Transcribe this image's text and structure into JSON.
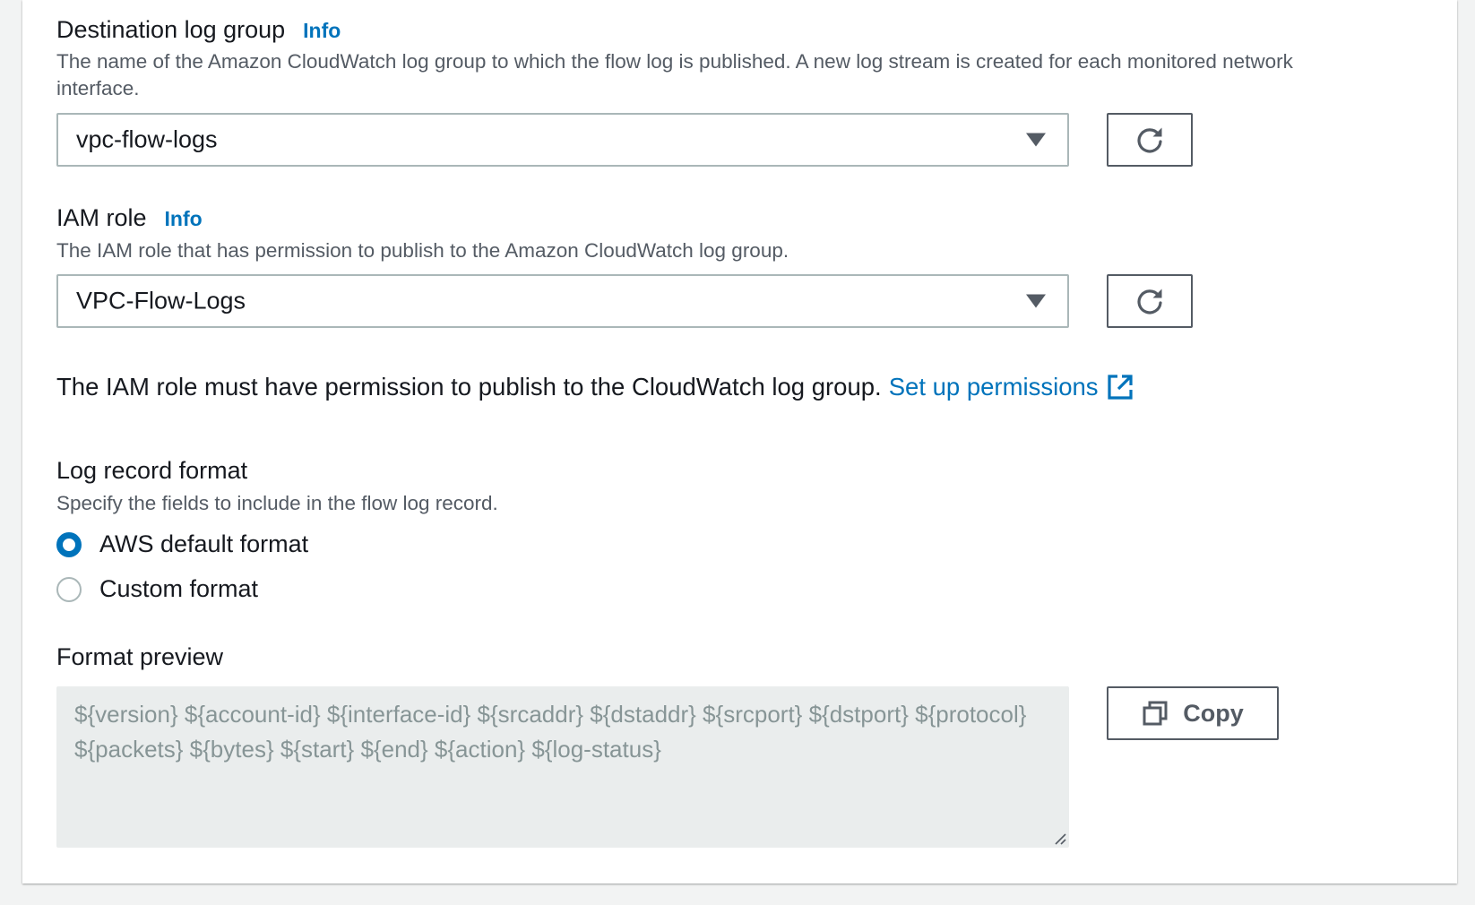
{
  "destination_log_group": {
    "label": "Destination log group",
    "info": "Info",
    "description": "The name of the Amazon CloudWatch log group to which the flow log is published. A new log stream is created for each monitored network interface.",
    "selected_value": "vpc-flow-logs"
  },
  "iam_role": {
    "label": "IAM role",
    "info": "Info",
    "description": "The IAM role that has permission to publish to the Amazon CloudWatch log group.",
    "selected_value": "VPC-Flow-Logs"
  },
  "permission_notice": {
    "text": "The IAM role must have permission to publish to the CloudWatch log group.",
    "link": "Set up permissions"
  },
  "log_record_format": {
    "label": "Log record format",
    "description": "Specify the fields to include in the flow log record.",
    "options": [
      {
        "label": "AWS default format",
        "checked": true
      },
      {
        "label": "Custom format",
        "checked": false
      }
    ]
  },
  "format_preview": {
    "label": "Format preview",
    "text": "${version} ${account-id} ${interface-id} ${srcaddr} ${dstaddr} ${srcport} ${dstport} ${protocol} ${packets} ${bytes} ${start} ${end} ${action} ${log-status}",
    "copy_label": "Copy"
  },
  "icons": {
    "refresh": "refresh-icon",
    "dropdown": "caret-down-icon",
    "external_link": "external-link-icon",
    "copy": "copy-icon",
    "resize": "resize-handle-icon"
  },
  "colors": {
    "link": "#0073bb",
    "text": "#16191f",
    "secondary_text": "#545b64",
    "border": "#aab7b8",
    "preview_background": "#eaeded",
    "page_background": "#f2f3f3"
  }
}
